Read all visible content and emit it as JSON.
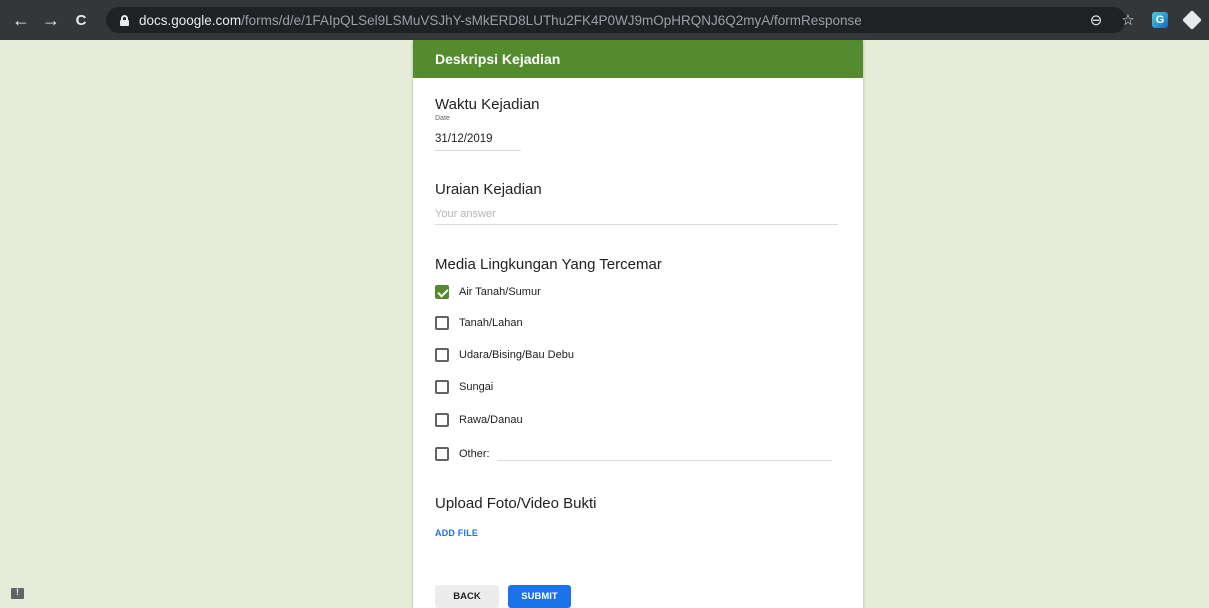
{
  "browser": {
    "back_icon": "←",
    "forward_icon": "→",
    "reload_icon": "C",
    "url_host": "docs.google.com",
    "url_path": "/forms/d/e/1FAIpQLSel9LSMuVSJhY-sMkERD8LUThu2FK4P0WJ9mOpHRQNJ6Q2myA/formResponse",
    "zoom_icon": "⊖",
    "star_icon": "☆",
    "ext_label": "G"
  },
  "form": {
    "section_title": "Deskripsi Kejadian",
    "waktu": {
      "title": "Waktu Kejadian",
      "subtitle": "Date",
      "value": "31/12/2019"
    },
    "uraian": {
      "title": "Uraian Kejadian",
      "placeholder": "Your answer"
    },
    "media": {
      "title": "Media Lingkungan Yang Tercemar",
      "options": [
        {
          "label": "Air Tanah/Sumur",
          "checked": true
        },
        {
          "label": "Tanah/Lahan",
          "checked": false
        },
        {
          "label": "Udara/Bising/Bau Debu",
          "checked": false
        },
        {
          "label": "Sungai",
          "checked": false
        },
        {
          "label": "Rawa/Danau",
          "checked": false
        },
        {
          "label": "Other:",
          "checked": false
        }
      ]
    },
    "upload": {
      "title": "Upload Foto/Video Bukti",
      "add_file_label": "ADD FILE"
    },
    "buttons": {
      "back": "BACK",
      "submit": "SUBMIT"
    }
  },
  "colors": {
    "accent": "#558b2f",
    "page_bg": "#e5edda",
    "link": "#1a73e8"
  }
}
